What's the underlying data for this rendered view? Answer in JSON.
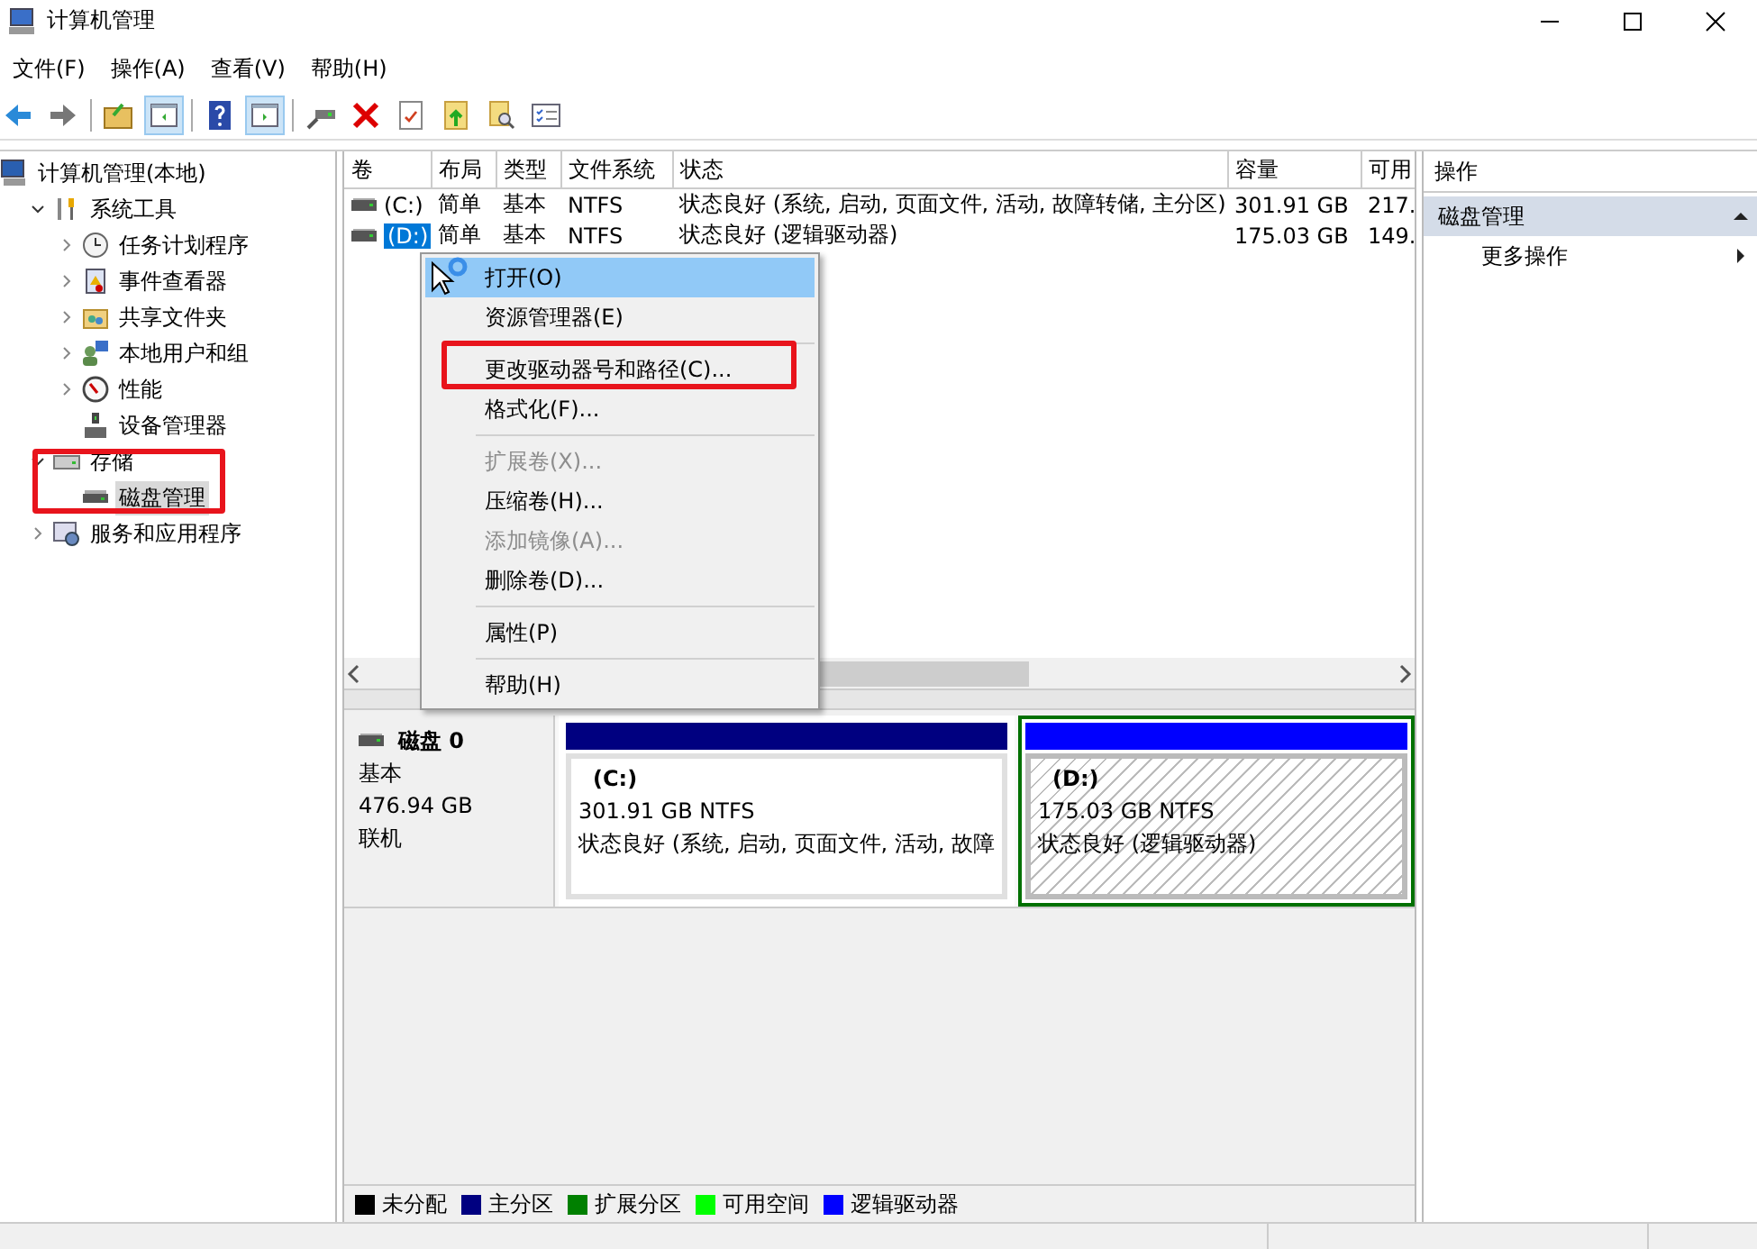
{
  "window": {
    "title": "计算机管理"
  },
  "menu_bar": [
    "文件(F)",
    "操作(A)",
    "查看(V)",
    "帮助(H)"
  ],
  "tree": {
    "label": "计算机管理(本地)",
    "selected": false,
    "children": [
      {
        "label": "系统工具",
        "expanded": true,
        "selected": false,
        "children": [
          {
            "label": "任务计划程序",
            "expanded": false,
            "selected": false
          },
          {
            "label": "事件查看器",
            "expanded": false,
            "selected": false
          },
          {
            "label": "共享文件夹",
            "expanded": false,
            "selected": false
          },
          {
            "label": "本地用户和组",
            "expanded": false,
            "selected": false
          },
          {
            "label": "性能",
            "expanded": false,
            "selected": false
          },
          {
            "label": "设备管理器",
            "selected": false
          }
        ]
      },
      {
        "label": "存储",
        "expanded": true,
        "selected": false,
        "children": [
          {
            "label": "磁盘管理",
            "selected": true
          }
        ]
      },
      {
        "label": "服务和应用程序",
        "expanded": false,
        "selected": false
      }
    ]
  },
  "volumes": {
    "columns": [
      "卷",
      "布局",
      "类型",
      "文件系统",
      "状态",
      "容量",
      "可用"
    ],
    "rows": [
      {
        "cells": [
          "(C:)",
          "简单",
          "基本",
          "NTFS",
          "状态良好 (系统, 启动, 页面文件, 活动, 故障转储, 主分区)",
          "301.91 GB",
          "217."
        ],
        "selected": false
      },
      {
        "cells": [
          "(D:)",
          "简单",
          "基本",
          "NTFS",
          "状态良好 (逻辑驱动器)",
          "175.03 GB",
          "149."
        ],
        "selected": true
      }
    ]
  },
  "context_menu": [
    {
      "kind": "item",
      "label": "打开(O)",
      "disabled": false,
      "selected": true
    },
    {
      "kind": "item",
      "label": "资源管理器(E)",
      "disabled": false,
      "selected": false
    },
    {
      "kind": "separator"
    },
    {
      "kind": "item",
      "label": "更改驱动器号和路径(C)...",
      "disabled": false,
      "selected": false
    },
    {
      "kind": "item",
      "label": "格式化(F)...",
      "disabled": false,
      "selected": false
    },
    {
      "kind": "separator"
    },
    {
      "kind": "item",
      "label": "扩展卷(X)...",
      "disabled": true,
      "selected": false
    },
    {
      "kind": "item",
      "label": "压缩卷(H)...",
      "disabled": false,
      "selected": false
    },
    {
      "kind": "item",
      "label": "添加镜像(A)...",
      "disabled": true,
      "selected": false
    },
    {
      "kind": "item",
      "label": "删除卷(D)...",
      "disabled": false,
      "selected": false
    },
    {
      "kind": "separator"
    },
    {
      "kind": "item",
      "label": "属性(P)",
      "disabled": false,
      "selected": false
    },
    {
      "kind": "separator"
    },
    {
      "kind": "item",
      "label": "帮助(H)",
      "disabled": false,
      "selected": false
    }
  ],
  "disk": {
    "name": "磁盘 0",
    "type": "基本",
    "size": "476.94 GB",
    "status": "联机",
    "partitions": [
      {
        "kind": "primary",
        "label": "(C:)",
        "size": "301.91 GB NTFS",
        "status": "状态良好 (系统, 启动, 页面文件, 活动, 故障",
        "selected": false
      },
      {
        "kind": "logical",
        "label": "(D:)",
        "size": "175.03 GB NTFS",
        "status": "状态良好 (逻辑驱动器)",
        "selected": true
      }
    ]
  },
  "legend": [
    {
      "label": "未分配",
      "color": "#000000"
    },
    {
      "label": "主分区",
      "color": "#000080"
    },
    {
      "label": "扩展分区",
      "color": "#008000"
    },
    {
      "label": "可用空间",
      "color": "#00ff00"
    },
    {
      "label": "逻辑驱动器",
      "color": "#0000ff"
    }
  ],
  "actions": {
    "title": "操作",
    "section": "磁盘管理",
    "items": [
      "更多操作"
    ]
  }
}
